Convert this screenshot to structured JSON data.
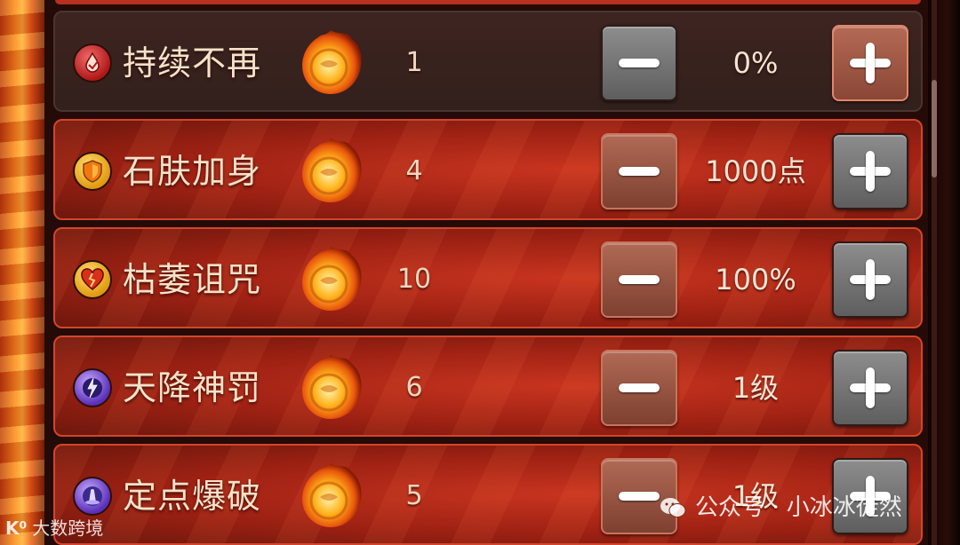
{
  "skills": [
    {
      "name": "持续不再",
      "count": "1",
      "value": "0%",
      "icon": "blood-drop-icon",
      "state": "selected"
    },
    {
      "name": "石肤加身",
      "count": "4",
      "value": "1000点",
      "icon": "shield-icon",
      "state": "normal"
    },
    {
      "name": "枯萎诅咒",
      "count": "10",
      "value": "100%",
      "icon": "broken-heart-icon",
      "state": "normal"
    },
    {
      "name": "天降神罚",
      "count": "6",
      "value": "1级",
      "icon": "lightning-icon",
      "state": "normal"
    },
    {
      "name": "定点爆破",
      "count": "5",
      "value": "1级",
      "icon": "blast-icon",
      "state": "normal"
    }
  ],
  "currency_icon": "fireball-icon",
  "colors": {
    "row_active": "#a82515",
    "row_selected": "#3a221e",
    "button_gray": "#7a7a7a",
    "button_rust": "#9a5542"
  },
  "watermarks": {
    "left": "大数跨境",
    "left_logo": "K⁰",
    "right": "公众号 · 小冰冰徒然"
  }
}
